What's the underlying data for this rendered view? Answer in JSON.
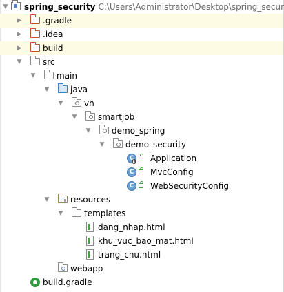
{
  "project": {
    "name": "spring_security",
    "path": "C:\\Users\\Administrator\\Desktop\\spring_security"
  },
  "tree": {
    "gradle_dir": ".gradle",
    "idea_dir": ".idea",
    "build_dir": "build",
    "src": "src",
    "main": "main",
    "java": "java",
    "vn": "vn",
    "smartjob": "smartjob",
    "demo_spring": "demo_spring",
    "demo_security": "demo_security",
    "classes": [
      "Application",
      "MvcConfig",
      "WebSecurityConfig"
    ],
    "resources": "resources",
    "templates": "templates",
    "html_files": [
      "dang_nhap.html",
      "khu_vuc_bao_mat.html",
      "trang_chu.html"
    ],
    "webapp": "webapp",
    "build_gradle": "build.gradle"
  },
  "icons": {
    "expanded": "chevron-down-icon",
    "collapsed": "chevron-right-icon",
    "folder": "folder-icon",
    "excluded_folder": "excluded-folder-icon",
    "source_folder": "source-folder-icon",
    "package": "package-icon",
    "class": "java-class-icon",
    "html": "html-file-icon",
    "gradle": "gradle-icon",
    "module": "module-icon"
  },
  "colors": {
    "excluded_row_bg": "#fdfbe4",
    "excluded_folder": "#c1542f",
    "source_folder": "#3a7ec3",
    "class_icon": "#6ba1d1",
    "gradle": "#2f9c3d"
  }
}
